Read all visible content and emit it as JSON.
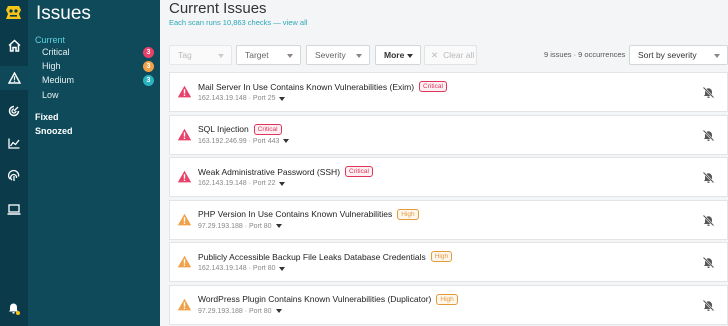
{
  "sidebar": {
    "title": "Issues",
    "current_label": "Current",
    "severity_items": [
      {
        "label": "Critical",
        "count": "3",
        "color": "#e8416a"
      },
      {
        "label": "High",
        "count": "3",
        "color": "#f0a24b"
      },
      {
        "label": "Medium",
        "count": "3",
        "color": "#2ab3c2"
      },
      {
        "label": "Low",
        "count": "",
        "color": ""
      }
    ],
    "fixed_label": "Fixed",
    "snoozed_label": "Snoozed"
  },
  "rail": {
    "icons": [
      "logo-icon",
      "home-icon",
      "issues-warning-icon",
      "scan-icon",
      "chart-icon",
      "fingerprint-icon",
      "laptop-icon",
      "notifications-bell-icon"
    ],
    "active": "issues-warning-icon",
    "notification_dot_color": "#f5c518"
  },
  "header": {
    "title": "Current Issues",
    "subtitle": "Each scan runs 10,863 checks — view all"
  },
  "filters": {
    "tag": "Tag",
    "target": "Target",
    "severity": "Severity",
    "more": "More",
    "clear_all": "Clear all",
    "summary": "9 issues · 9 occurrences",
    "sort": "Sort by severity"
  },
  "issues": [
    {
      "title": "Mail Server In Use Contains Known Vulnerabilities (Exim)",
      "severity": "Critical",
      "level": "critical",
      "host": "162.143.19.148",
      "port": "Port 25"
    },
    {
      "title": "SQL Injection",
      "severity": "Critical",
      "level": "critical",
      "host": "163.192.246.99",
      "port": "Port 443"
    },
    {
      "title": "Weak Administrative Password (SSH)",
      "severity": "Critical",
      "level": "critical",
      "host": "162.143.19.148",
      "port": "Port 22"
    },
    {
      "title": "PHP Version In Use Contains Known Vulnerabilities",
      "severity": "High",
      "level": "high",
      "host": "97.29.193.188",
      "port": "Port 80"
    },
    {
      "title": "Publicly Accessible Backup File Leaks Database Credentials",
      "severity": "High",
      "level": "high",
      "host": "162.143.19.148",
      "port": "Port 80"
    },
    {
      "title": "WordPress Plugin Contains Known Vulnerabilities (Duplicator)",
      "severity": "High",
      "level": "high",
      "host": "97.29.193.188",
      "port": "Port 80"
    }
  ],
  "colors": {
    "critical": "#e8416a",
    "high": "#f0a24b",
    "sidebar_bg": "#0f4a5a",
    "rail_bg": "#0b3a4a",
    "accent": "#2aa7b8"
  }
}
